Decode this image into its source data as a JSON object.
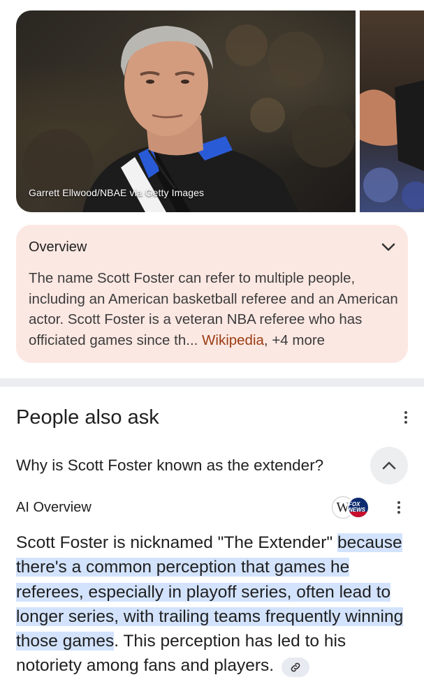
{
  "carousel": {
    "main_photo_caption": "Garrett Ellwood/NBAE via Getty Images"
  },
  "overview": {
    "title": "Overview",
    "text": "The name Scott Foster can refer to multiple people, including an American basketball referee and an American actor. Scott Foster is a veteran NBA referee who has officiated games since th",
    "ellipsis": "... ",
    "source_link": "Wikipedia",
    "more_sources": ", +4 more",
    "card_color": "#fce8e3",
    "link_color": "#9b3c13"
  },
  "people_also_ask": {
    "title": "People also ask",
    "question": "Why is Scott Foster known as the extender?",
    "ai_overview_label": "AI Overview",
    "source_icons": [
      "wikipedia-icon",
      "fox-news-icon"
    ],
    "fox_logo_text": "FOX NEWS",
    "wiki_logo_text": "W",
    "answer_intro": "Scott Foster is nicknamed \"The Extender\" ",
    "answer_highlight": "because there's a common perception that games he referees, especially in playoff series, often lead to longer series, with trailing teams frequently winning those games",
    "answer_outro": ". This perception has led to his notoriety among fans and players.",
    "highlight_color": "#d3e3fd"
  }
}
